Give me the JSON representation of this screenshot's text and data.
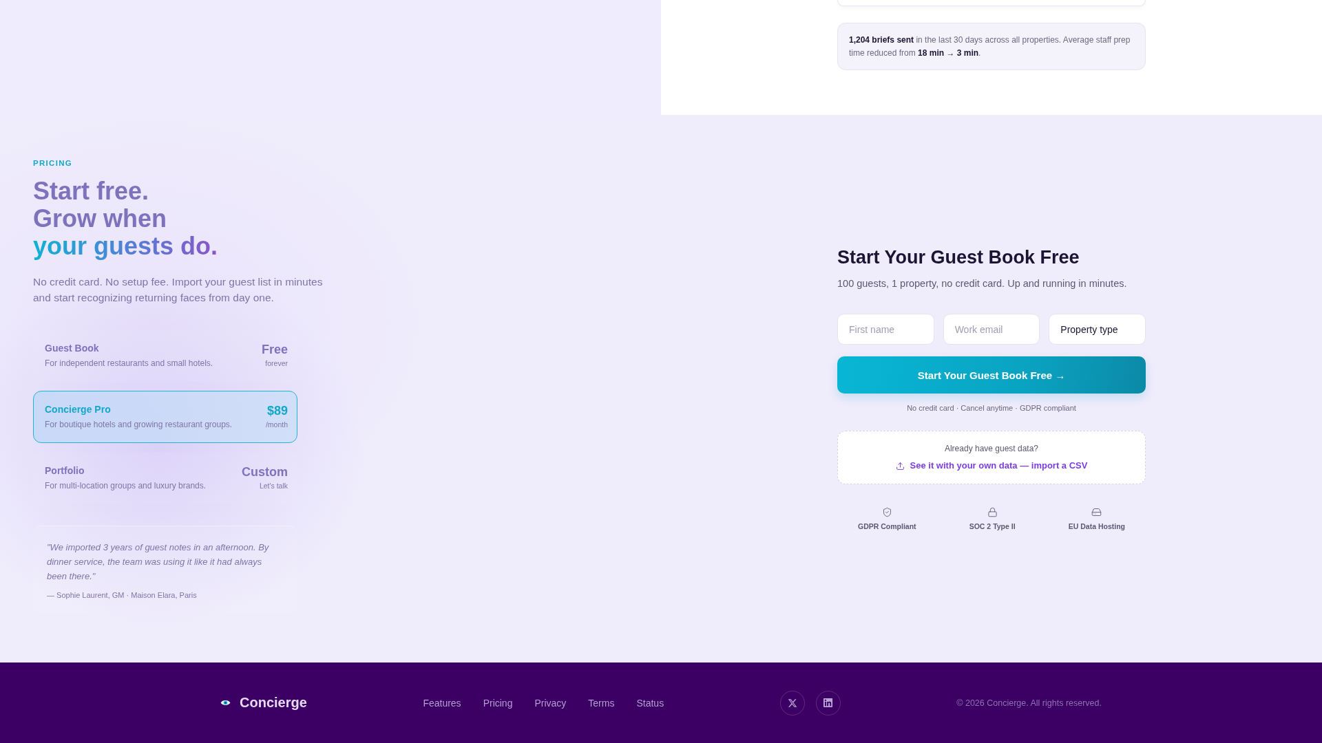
{
  "top_section": {
    "stats_note": "**1,204 briefs sent** in the last 30 days across all properties. Average staff prep time reduced from **18 min → 3 min**."
  },
  "pricing": {
    "eyebrow": "PRICING",
    "headline": [
      "Start free.",
      "Grow when"
    ],
    "headline_accent": "your guests do.",
    "intro": "No credit card. No setup fee. Import your guest list in minutes and start recognizing returning faces from day one.",
    "plans": [
      {
        "name": "Guest Book",
        "description": "For independent restaurants and small hotels.",
        "price": "Free",
        "price_note": "forever",
        "selected": false
      },
      {
        "name": "Concierge Pro",
        "description": "For boutique hotels and growing restaurant groups.",
        "price": "$89",
        "price_note": "/month",
        "selected": true
      },
      {
        "name": "Portfolio",
        "description": "For multi-location groups and luxury brands.",
        "price": "Custom",
        "price_note": "Let's talk",
        "selected": false
      }
    ],
    "testimonial": {
      "quote": "\"We imported 3 years of guest notes in an afternoon. By dinner service, the team was using it like it had always been there.\"",
      "attribution": "— Sophie Laurent, GM · Maison Elara, Paris"
    }
  },
  "signup": {
    "title": "Start Your Guest Book Free",
    "subtitle": "100 guests, 1 property, no credit card. Up and running in minutes.",
    "fields": [
      {
        "kind": "input",
        "placeholder": "First name"
      },
      {
        "kind": "input",
        "placeholder": "Work email"
      },
      {
        "kind": "select",
        "value": "Property type"
      }
    ],
    "submit": "Start Your Guest Book Free →",
    "fine_print": "No credit card · Cancel anytime · GDPR compliant",
    "import": {
      "prompt": "Already have guest data?",
      "link": "See it with your own data — import a CSV"
    },
    "trust": [
      {
        "kind": "shield",
        "label": "GDPR Compliant"
      },
      {
        "kind": "lock",
        "label": "SOC 2 Type II"
      },
      {
        "kind": "drive",
        "label": "EU Data Hosting"
      }
    ]
  },
  "footer": {
    "brand": "Concierge",
    "links": [
      "Features",
      "Pricing",
      "Privacy",
      "Terms",
      "Status"
    ],
    "social": [
      {
        "kind": "x"
      },
      {
        "kind": "linkedin"
      }
    ],
    "copyright": "© 2026 Concierge. All rights reserved."
  }
}
